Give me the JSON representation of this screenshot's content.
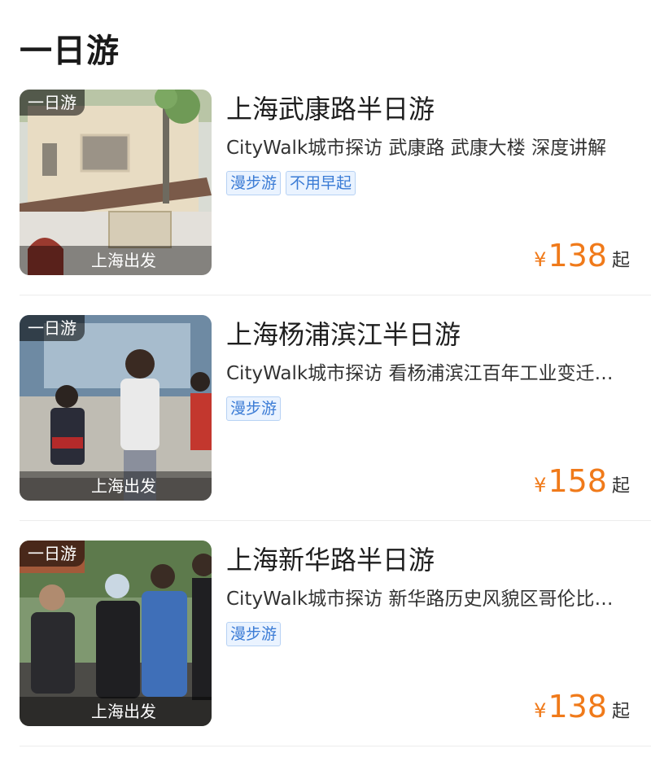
{
  "section": {
    "title": "一日游"
  },
  "items": [
    {
      "thumb_tag": "一日游",
      "thumb_departure": "上海出发",
      "name": "上海武康路半日游",
      "desc": "CityWalk城市探访 武康路 武康大楼 深度讲解",
      "tags": [
        "漫步游",
        "不用早起"
      ],
      "price": {
        "currency": "¥",
        "amount": "138",
        "suffix": "起"
      }
    },
    {
      "thumb_tag": "一日游",
      "thumb_departure": "上海出发",
      "name": "上海杨浦滨江半日游",
      "desc": "CityWalk城市探访 看杨浦滨江百年工业变迁…",
      "tags": [
        "漫步游"
      ],
      "price": {
        "currency": "¥",
        "amount": "158",
        "suffix": "起"
      }
    },
    {
      "thumb_tag": "一日游",
      "thumb_departure": "上海出发",
      "name": "上海新华路半日游",
      "desc": "CityWalk城市探访 新华路历史风貌区哥伦比…",
      "tags": [
        "漫步游"
      ],
      "price": {
        "currency": "¥",
        "amount": "138",
        "suffix": "起"
      }
    }
  ],
  "colors": {
    "price": "#f07a1a",
    "tag_text": "#3a7bd5",
    "tag_bg": "#eaf3ff"
  }
}
